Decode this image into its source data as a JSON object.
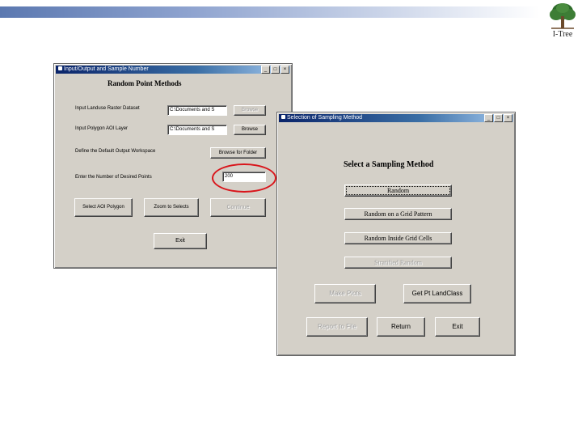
{
  "colors": {
    "accent_circle": "#d9151b",
    "titlebar": "#0a246a",
    "window_face": "#d4d0c8"
  },
  "logo": {
    "text": "I-Tree",
    "icon": "tree-icon"
  },
  "window1": {
    "title": "Input/Output and Sample Number",
    "controls": [
      "_",
      "□",
      "×"
    ],
    "heading": "Random Point Methods",
    "landuse_label": "Input Landuse Raster Dataset",
    "landuse_value": "C:\\Documents and S",
    "browse1": "Browse",
    "polygon_label": "Input Polygon AOI Layer",
    "polygon_value": "C:\\Documents and S",
    "browse2": "Browse",
    "workspace_label": "Define the Default Output Workspace",
    "browse_folder": "Browse for Folder",
    "points_label": "Enter the Number of Desired Points",
    "points_value": "200",
    "select_aoi": "Select AOI Polygon",
    "zoom_selects": "Zoom to Selects",
    "continue": "Continue",
    "exit": "Exit"
  },
  "window2": {
    "title": "Selection of Sampling Method",
    "controls": [
      "_",
      "□",
      "×"
    ],
    "heading": "Select a  Sampling Method",
    "random": "Random",
    "random_grid": "Random on a Grid Pattern",
    "random_inside": "Random Inside Grid Cells",
    "stratified": "Stratified Random",
    "make_plots": "Make Plots",
    "get_landclass": "Get Pt LandClass",
    "report_file": "Report to File",
    "return": "Return",
    "exit": "Exit"
  }
}
